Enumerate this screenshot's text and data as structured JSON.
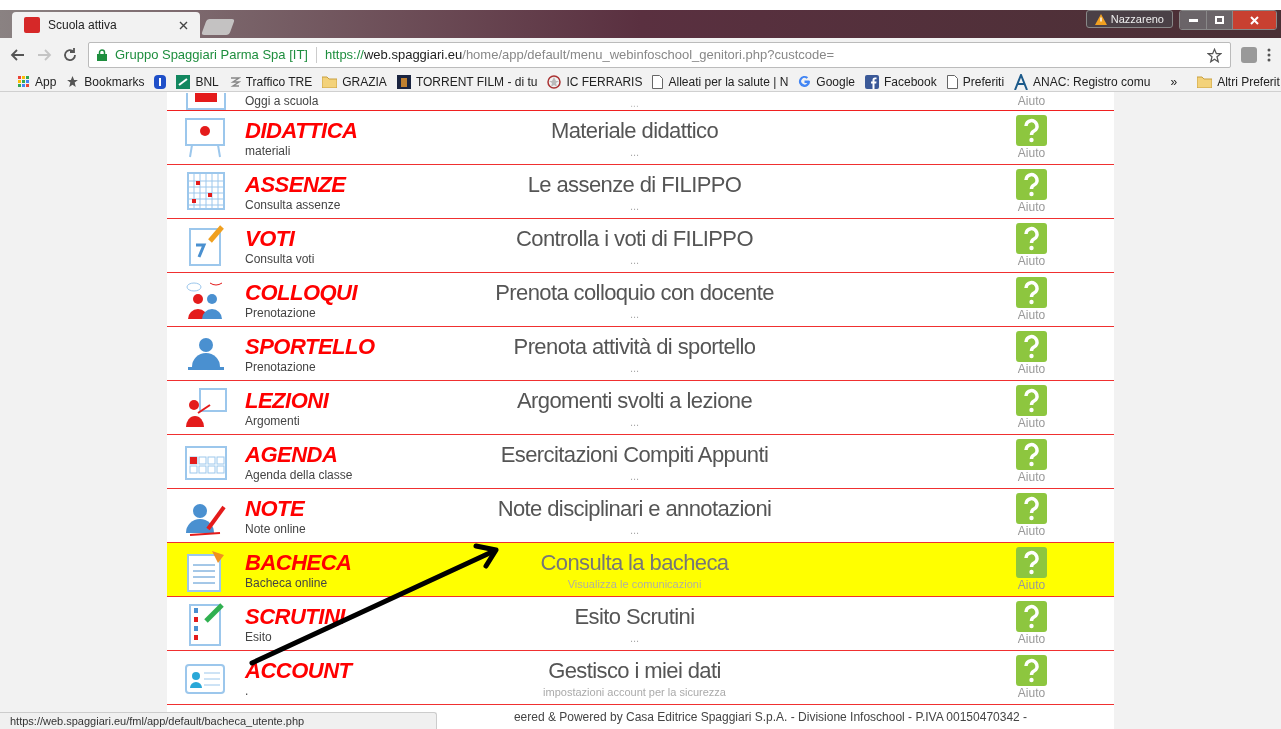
{
  "browser": {
    "tabs": [
      {
        "title": "Scuola attiva",
        "selected": true
      }
    ],
    "profile": "Nazzareno",
    "nav": [
      {
        "kind": "back",
        "disabled": false
      },
      {
        "kind": "forward",
        "disabled": true
      },
      {
        "kind": "reload",
        "disabled": false
      }
    ],
    "url": {
      "site_name": "Gruppo Spaggiari Parma Spa [IT]",
      "scheme": "https://",
      "host": "web.spaggiari.eu",
      "path": "/home/app/default/menu_webinfoschool_genitori.php?custcode="
    },
    "bookmarks": [
      {
        "label": "App"
      },
      {
        "label": "Bookmarks"
      },
      {
        "kind": "icon_only"
      },
      {
        "label": "BNL"
      },
      {
        "label": "Traffico TRE"
      },
      {
        "label": "GRAZIA"
      },
      {
        "label": "TORRENT FILM - di tu"
      },
      {
        "label": "IC FERRARIS"
      },
      {
        "label": "Alleati per la salute | N"
      },
      {
        "label": "Google"
      },
      {
        "label": "Facebook"
      },
      {
        "label": "Preferiti"
      },
      {
        "label": "ANAC: Registro comu"
      }
    ],
    "bookmarks_overflow": "»",
    "other_bookmarks": "Altri Preferit"
  },
  "menu": {
    "partial_row": {
      "subtitle": "Oggi a scuola",
      "detail": "...",
      "help": "Aiuto"
    },
    "rows": [
      {
        "title": "DIDATTICA",
        "subtitle": "materiali",
        "description": "Materiale didattico",
        "detail": "...",
        "help": "Aiuto",
        "selected": false
      },
      {
        "title": "ASSENZE",
        "subtitle": "Consulta assenze",
        "description": "Le assenze di FILIPPO",
        "detail": "...",
        "help": "Aiuto",
        "selected": false
      },
      {
        "title": "VOTI",
        "subtitle": "Consulta voti",
        "description": "Controlla i voti di FILIPPO",
        "detail": "...",
        "help": "Aiuto",
        "selected": false
      },
      {
        "title": "COLLOQUI",
        "subtitle": "Prenotazione",
        "description": "Prenota colloquio con docente",
        "detail": "...",
        "help": "Aiuto",
        "selected": false
      },
      {
        "title": "SPORTELLO",
        "subtitle": "Prenotazione",
        "description": "Prenota attività di sportello",
        "detail": "...",
        "help": "Aiuto",
        "selected": false
      },
      {
        "title": "LEZIONI",
        "subtitle": "Argomenti",
        "description": "Argomenti svolti a lezione",
        "detail": "...",
        "help": "Aiuto",
        "selected": false
      },
      {
        "title": "AGENDA",
        "subtitle": "Agenda della classe",
        "description": "Esercitazioni Compiti Appunti",
        "detail": "...",
        "help": "Aiuto",
        "selected": false
      },
      {
        "title": "NOTE",
        "subtitle": "Note online",
        "description": "Note disciplinari e annotazioni",
        "detail": "...",
        "help": "Aiuto",
        "selected": false
      },
      {
        "title": "BACHECA",
        "subtitle": "Bacheca online",
        "description": "Consulta la bacheca",
        "detail": "Visualizza le comunicazioni",
        "help": "Aiuto",
        "selected": true
      },
      {
        "title": "SCRUTINI",
        "subtitle": "Esito",
        "description": "Esito Scrutini",
        "detail": "...",
        "help": "Aiuto",
        "selected": false
      },
      {
        "title": "ACCOUNT",
        "subtitle": ".",
        "description": "Gestisco i miei dati",
        "detail": "impostazioni account per la sicurezza",
        "help": "Aiuto",
        "selected": false
      }
    ]
  },
  "footer": "eered & Powered by Casa Editrice Spaggiari S.p.A. - Divisione Infoschool - P.IVA 00150470342 -",
  "status_url": "https://web.spaggiari.eu/fml/app/default/bacheca_utente.php"
}
